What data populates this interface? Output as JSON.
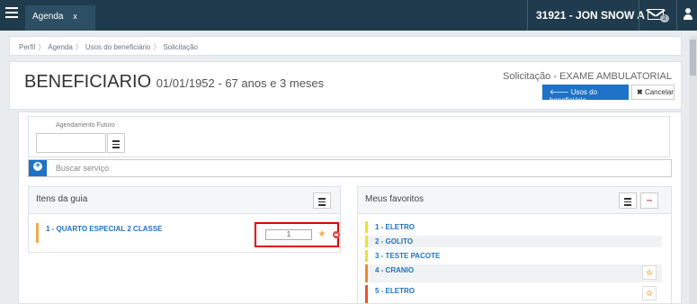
{
  "topbar": {
    "tab_label": "Agenda",
    "tab_close": "x",
    "user": "31921 - JON SNOW A",
    "mail_count": "2"
  },
  "breadcrumb": [
    "Perfil",
    "Agenda",
    "Usos do beneficiário",
    "Solicitação"
  ],
  "header": {
    "title": "BENEFICIARIO",
    "subtitle": "01/01/1952 - 67 anos e 3 meses",
    "request_label": "Solicitação - EXAME AMBULATORIAL",
    "usos_button": "Usos do beneficiário",
    "cancel_button": "Cancelar"
  },
  "agendamento": {
    "label": "Agendamento Futuro",
    "value": ""
  },
  "search": {
    "placeholder": "Buscar serviço"
  },
  "itens_guia": {
    "title": "Itens da guia",
    "items": [
      {
        "label": "1 - QUARTO ESPECIAL 2 CLASSE",
        "qty": "1"
      }
    ]
  },
  "favoritos": {
    "title": "Meus favoritos",
    "items": [
      {
        "label": "1 - ELETRO",
        "color": "#f2e02b",
        "star": false
      },
      {
        "label": "2 - GOLITO",
        "color": "#f2e02b",
        "star": false
      },
      {
        "label": "3 - TESTE PACOTE",
        "color": "#f2e02b",
        "star": false
      },
      {
        "label": "4 - CRANIO",
        "color": "#f08a2c",
        "star": true
      },
      {
        "label": "5 - ELETRO",
        "color": "#e8562a",
        "star": true
      }
    ]
  },
  "colors": {
    "topbar": "#1f3b4d",
    "primary": "#1e73c6",
    "highlight": "#e30000"
  }
}
